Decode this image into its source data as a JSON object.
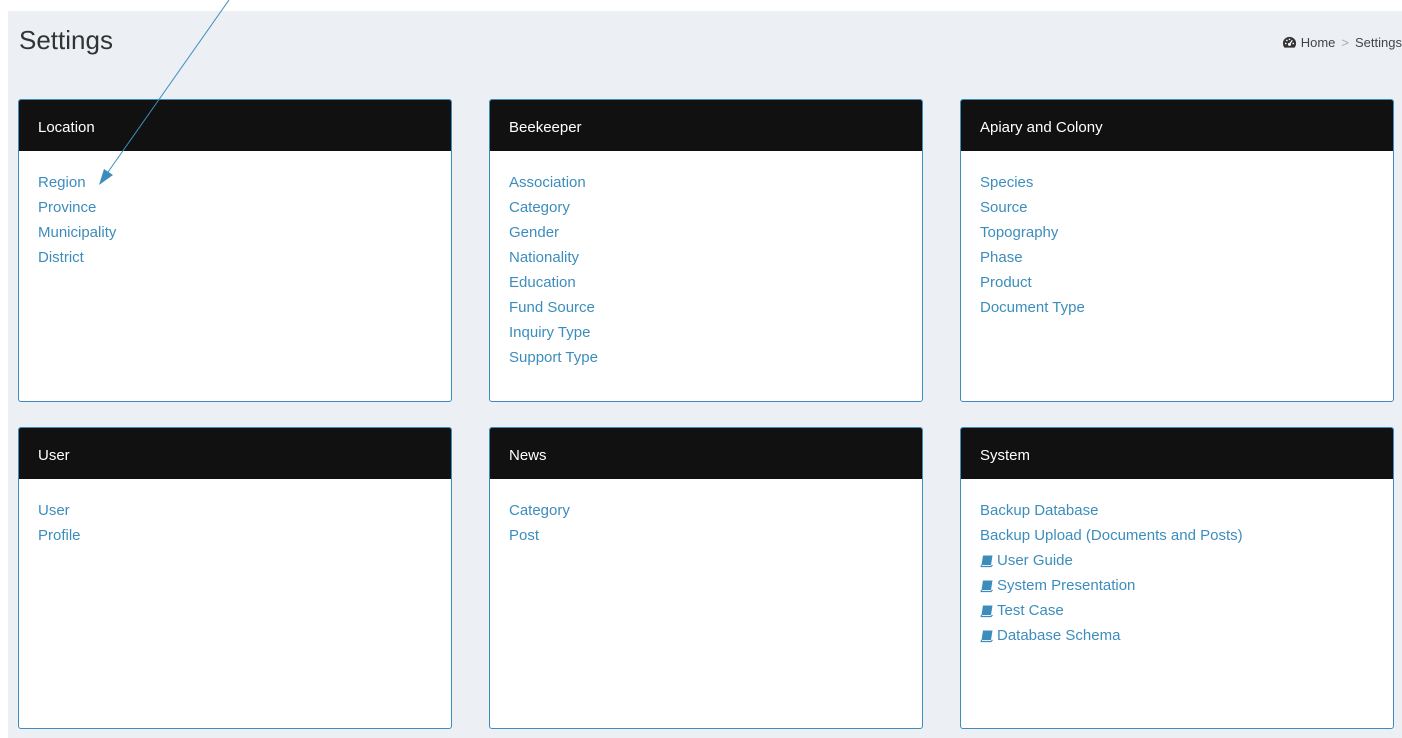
{
  "header": {
    "title": "Settings",
    "breadcrumb": {
      "home": "Home",
      "separator": ">",
      "current": "Settings"
    }
  },
  "boxes": [
    {
      "title": "Location",
      "links": [
        "Region",
        "Province",
        "Municipality",
        "District"
      ]
    },
    {
      "title": "Beekeeper",
      "links": [
        "Association",
        "Category",
        "Gender",
        "Nationality",
        "Education",
        "Fund Source",
        "Inquiry Type",
        "Support Type"
      ]
    },
    {
      "title": "Apiary and Colony",
      "links": [
        "Species",
        "Source",
        "Topography",
        "Phase",
        "Product",
        "Document Type"
      ]
    },
    {
      "title": "User",
      "links": [
        "User",
        "Profile"
      ]
    },
    {
      "title": "News",
      "links": [
        "Category",
        "Post"
      ]
    },
    {
      "title": "System",
      "links": [
        "Backup Database",
        "Backup Upload (Documents and Posts)",
        "User Guide",
        "System Presentation",
        "Test Case",
        "Database Schema"
      ]
    }
  ],
  "icons": {
    "breadcrumb_home": "dashboard-icon",
    "doc_links": "book-icon"
  },
  "colors": {
    "box_header_bg": "#111111",
    "link": "#3c8dbc",
    "box_border": "#3c8dbc",
    "content_bg": "#ecf0f5",
    "annotation_arrow": "#3c8dbc"
  }
}
